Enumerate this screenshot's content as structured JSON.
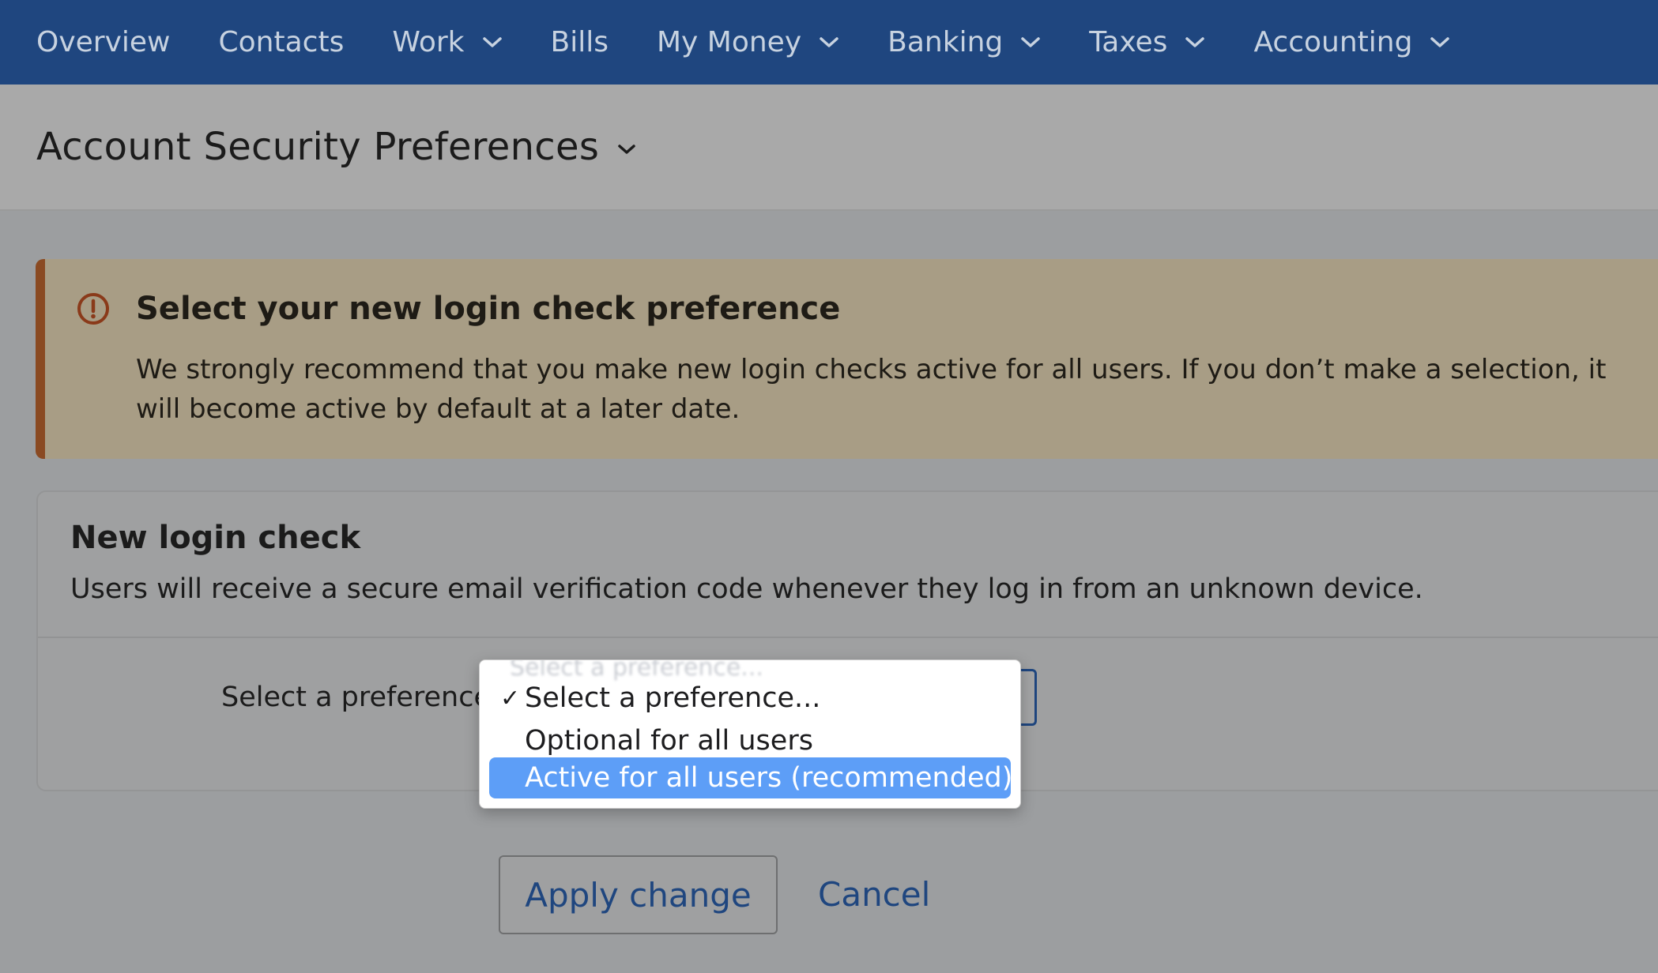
{
  "nav": {
    "items": [
      {
        "label": "Overview",
        "has_menu": false
      },
      {
        "label": "Contacts",
        "has_menu": false
      },
      {
        "label": "Work",
        "has_menu": true
      },
      {
        "label": "Bills",
        "has_menu": false
      },
      {
        "label": "My Money",
        "has_menu": true
      },
      {
        "label": "Banking",
        "has_menu": true
      },
      {
        "label": "Taxes",
        "has_menu": true
      },
      {
        "label": "Accounting",
        "has_menu": true
      }
    ]
  },
  "header": {
    "title": "Account Security Preferences"
  },
  "banner": {
    "icon": "alert-circle-icon",
    "title": "Select your new login check preference",
    "text": "We strongly recommend that you make new login checks active for all users. If you don’t make a selection, it will become active by default at a later date."
  },
  "card": {
    "title": "New login check",
    "description": "Users will receive a secure email verification code whenever they log in from an unknown device.",
    "preference_label": "Select a preference",
    "select": {
      "selected_value": "Select a preference...",
      "options": [
        {
          "label": "Select a preference...",
          "checked": true,
          "highlighted": false
        },
        {
          "label": "Optional for all users",
          "checked": false,
          "highlighted": false
        },
        {
          "label": "Active for all users (recommended)",
          "checked": false,
          "highlighted": true
        }
      ]
    }
  },
  "actions": {
    "apply_label": "Apply change",
    "cancel_label": "Cancel"
  },
  "colors": {
    "nav_bg": "#1f467f",
    "banner_accent": "#8a4a22",
    "highlight": "#5d9ef7",
    "link": "#1f467f"
  }
}
